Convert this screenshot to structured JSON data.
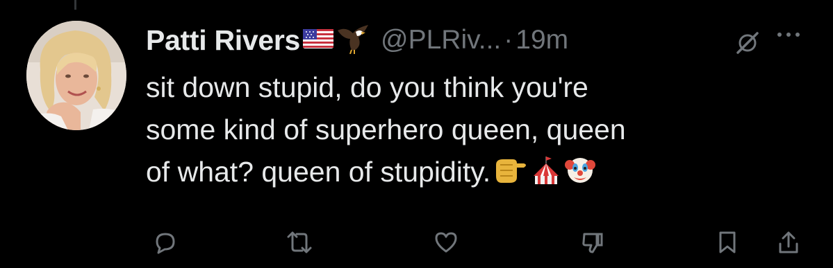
{
  "tweet": {
    "author": {
      "display_name": "Patti Rivers",
      "badges": [
        "us-flag-emoji",
        "eagle-emoji"
      ],
      "handle": "@PLRiv...",
      "separator": "·",
      "timestamp": "19m"
    },
    "text_lines": [
      "sit down stupid, do you think you're",
      "some kind of superhero queen, queen",
      "of what? queen of stupidity."
    ],
    "trailing_emojis": [
      "backhand-index-pointing-right-emoji",
      "circus-tent-emoji",
      "clown-face-emoji"
    ]
  },
  "actions": [
    "reply",
    "retweet",
    "like",
    "downvote",
    "bookmark",
    "share"
  ],
  "header_actions": [
    "grok-icon",
    "more-icon"
  ],
  "colors": {
    "background": "#000000",
    "primary_text": "#e7e9ea",
    "secondary_text": "#71767b",
    "icon": "#71767b",
    "thread_line": "#333639"
  }
}
